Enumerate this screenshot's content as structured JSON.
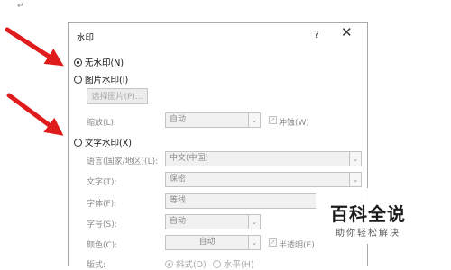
{
  "document": {
    "paragraph_mark": "↵"
  },
  "dialog": {
    "title": "水印",
    "help_label": "?",
    "close_label": "✕",
    "no_watermark": "无水印(N)",
    "picture_watermark": "图片水印(I)",
    "select_picture_button": "选择图片(P)...",
    "scale_label": "缩放(L):",
    "scale_value": "自动",
    "washout_label": "冲蚀(W)",
    "text_watermark": "文字水印(X)",
    "language_label": "语言(国家/地区)(L):",
    "language_value": "中文(中国)",
    "text_label": "文字(T):",
    "text_value": "保密",
    "font_label": "字体(F):",
    "font_value": "等线",
    "size_label": "字号(S):",
    "size_value": "自动",
    "color_label": "颜色(C):",
    "color_value": "自动",
    "semitransparent_label": "半透明(E)",
    "layout_label": "版式:",
    "diagonal_label": "斜式(D)",
    "horizontal_label": "水平(H)",
    "selected_option": "无水印(N)"
  },
  "overlay_watermark": {
    "main": "百科全说",
    "sub": "助你轻松解决"
  },
  "colors": {
    "annotation_arrow": "#e01b1b",
    "disabled_text": "#8c8c8c"
  }
}
